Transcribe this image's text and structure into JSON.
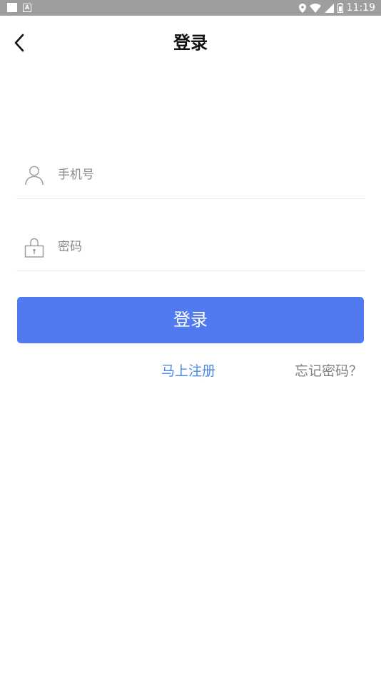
{
  "status_bar": {
    "time": "11:19",
    "left_icons": [
      "square-icon",
      "a-notification-icon"
    ],
    "right_icons": [
      "location-icon",
      "wifi-icon",
      "signal-icon",
      "battery-icon"
    ]
  },
  "header": {
    "title": "登录",
    "back_icon": "back-arrow-icon"
  },
  "form": {
    "phone": {
      "placeholder": "手机号",
      "value": "",
      "icon": "user-icon"
    },
    "password": {
      "placeholder": "密码",
      "value": "",
      "icon": "lock-icon"
    },
    "login_label": "登录",
    "register_label": "马上注册",
    "forgot_label": "忘记密码？"
  },
  "colors": {
    "primary": "#527af0",
    "link": "#4a8be8",
    "muted": "#808080",
    "status_bar": "#9e9e9e"
  }
}
